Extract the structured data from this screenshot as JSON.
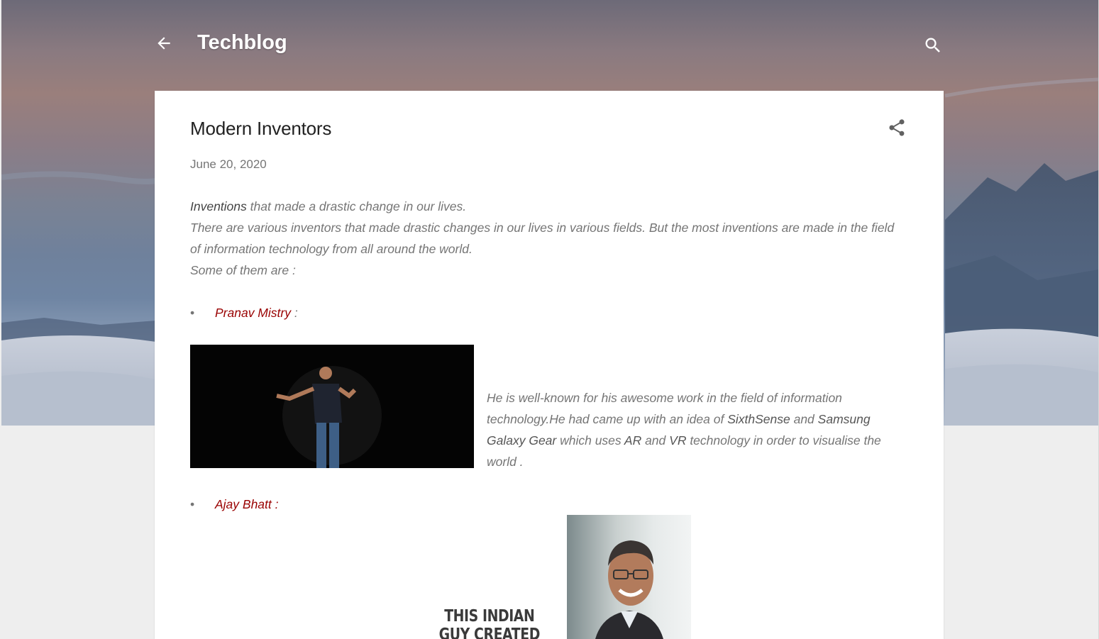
{
  "header": {
    "back_icon": "arrow-left-icon",
    "title": "Techblog",
    "search_icon": "search-icon"
  },
  "post": {
    "title": "Modern Inventors",
    "share_icon": "share-icon",
    "date": "June 20, 2020",
    "intro": {
      "lead_bold": "Inventions",
      "lead_rest": " that made a drastic change in our lives.",
      "line2": "There are various inventors that made drastic  changes in our lives in various fields. But the most inventions are made in the field of information technology from all around the world.",
      "line3": "Some of them are :"
    },
    "inventors": [
      {
        "bullet": "•",
        "name": "Pranav Mistry",
        "suffix": " :",
        "description": {
          "p1": " He is well-known for his awesome work in the field of information technology.He had came up with an idea of ",
          "b1": "SixthSense",
          "p2": " and ",
          "b2": "Samsung Galaxy Gear",
          "p3": " which uses ",
          "b3": "AR",
          "p4": " and ",
          "b4": "VR",
          "p5": " technology in order to visualise the world ."
        }
      },
      {
        "bullet": "•",
        "name": "Ajay Bhatt :",
        "image_caption": "THIS INDIAN GUY CREATED USB"
      }
    ]
  },
  "colors": {
    "accent_link": "#990000",
    "card": "#ffffff",
    "page_bg": "#eeeeee"
  }
}
